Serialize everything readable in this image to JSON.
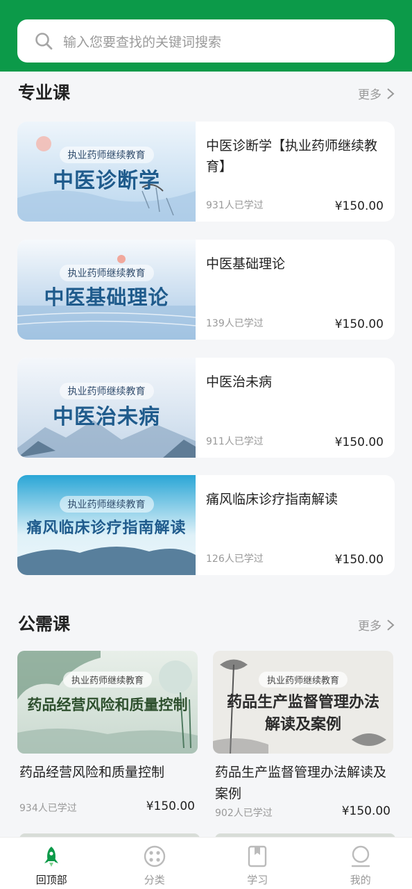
{
  "search": {
    "placeholder": "输入您要查找的关键词搜索"
  },
  "colors": {
    "brand": "#0c9a49",
    "price": "#222222",
    "muted": "#999999"
  },
  "professional": {
    "title": "专业课",
    "more": "更多",
    "courses": [
      {
        "title": "中医诊断学【执业药师继续教育】",
        "learners": "931人已学过",
        "price": "¥150.00",
        "thumb_tag": "执业药师继续教育",
        "thumb_title": "中医诊断学"
      },
      {
        "title": "中医基础理论",
        "learners": "139人已学过",
        "price": "¥150.00",
        "thumb_tag": "执业药师继续教育",
        "thumb_title": "中医基础理论"
      },
      {
        "title": "中医治未病",
        "learners": "911人已学过",
        "price": "¥150.00",
        "thumb_tag": "执业药师继续教育",
        "thumb_title": "中医治未病"
      },
      {
        "title": "痛风临床诊疗指南解读",
        "learners": "126人已学过",
        "price": "¥150.00",
        "thumb_tag": "执业药师继续教育",
        "thumb_title": "痛风临床诊疗指南解读"
      }
    ]
  },
  "public": {
    "title": "公需课",
    "more": "更多",
    "courses": [
      {
        "title": "药品经营风险和质量控制",
        "learners": "934人已学过",
        "price": "¥150.00",
        "thumb_tag": "执业药师继续教育",
        "thumb_title": "药品经营风险和质量控制"
      },
      {
        "title": "药品生产监督管理办法解读及案例",
        "learners": "902人已学过",
        "price": "¥150.00",
        "thumb_tag": "执业药师继续教育",
        "thumb_title_1": "药品生产监督管理办法",
        "thumb_title_2": "解读及案例"
      }
    ]
  },
  "tabbar": {
    "items": [
      {
        "label": "回顶部",
        "icon": "rocket-icon",
        "active": true
      },
      {
        "label": "分类",
        "icon": "category-icon",
        "active": false
      },
      {
        "label": "学习",
        "icon": "study-icon",
        "active": false
      },
      {
        "label": "我的",
        "icon": "profile-icon",
        "active": false
      }
    ]
  }
}
